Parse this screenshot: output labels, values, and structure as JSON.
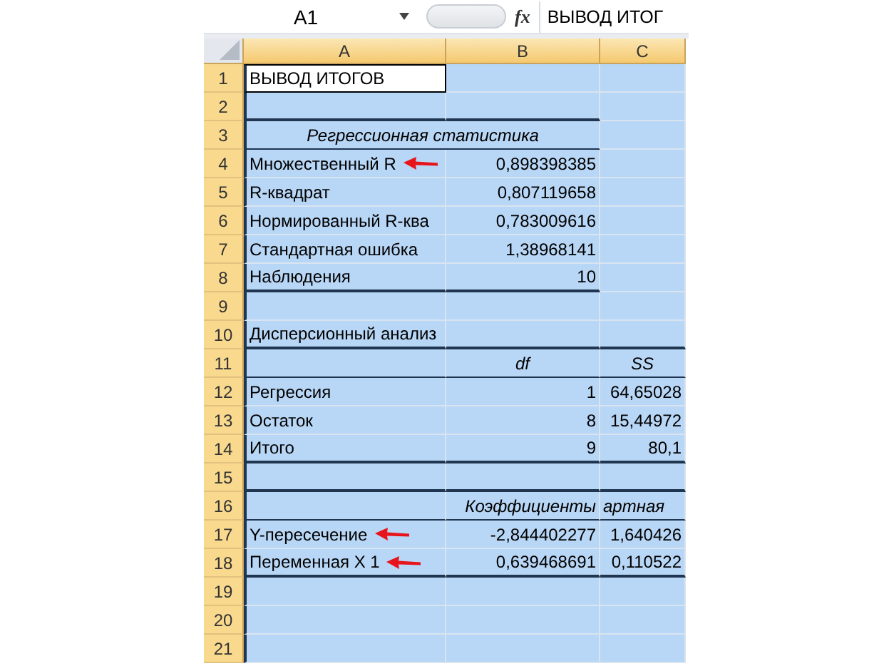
{
  "formula_bar": {
    "name_box": "A1",
    "function_button": "fx",
    "formula": "ВЫВОД ИТОГ"
  },
  "columns": [
    {
      "label": "A",
      "selected": true
    },
    {
      "label": "B",
      "selected": true
    },
    {
      "label": "C",
      "selected": true
    }
  ],
  "rows": [
    {
      "number": "1",
      "selected": true,
      "arrow": false,
      "cells": [
        {
          "text": "ВЫВОД ИТОГОВ",
          "kind": "label",
          "active": true,
          "border_below": false
        },
        {
          "kind": "empty",
          "active": false,
          "border_below": false
        },
        {
          "kind": "empty",
          "active": false,
          "border_below": false
        }
      ]
    },
    {
      "number": "2",
      "selected": true,
      "arrow": false,
      "cells": [
        {
          "kind": "empty",
          "active": false,
          "border_below": true,
          "thick_border": true
        },
        {
          "kind": "empty",
          "active": false,
          "border_below": true,
          "thick_border": true
        },
        {
          "kind": "empty",
          "active": false,
          "border_below": false
        }
      ]
    },
    {
      "number": "3",
      "selected": true,
      "arrow": false,
      "cells": [
        {
          "text": "Регрессионная статистика",
          "kind": "heading_span",
          "active": false,
          "border_below": true,
          "thick_border": false
        },
        {
          "kind": "empty",
          "active": false,
          "border_below": false
        }
      ]
    },
    {
      "number": "4",
      "selected": true,
      "arrow": true,
      "cells": [
        {
          "text": "Множественный R",
          "kind": "label",
          "active": false,
          "border_below": false
        },
        {
          "text": "0,898398385",
          "kind": "number",
          "active": false,
          "border_below": false
        },
        {
          "kind": "empty",
          "active": false,
          "border_below": false
        }
      ]
    },
    {
      "number": "5",
      "selected": true,
      "arrow": false,
      "cells": [
        {
          "text": "R-квадрат",
          "kind": "label",
          "active": false,
          "border_below": false
        },
        {
          "text": "0,807119658",
          "kind": "number",
          "active": false,
          "border_below": false
        },
        {
          "kind": "empty",
          "active": false,
          "border_below": false
        }
      ]
    },
    {
      "number": "6",
      "selected": true,
      "arrow": false,
      "cells": [
        {
          "text": "Нормированный R-ква",
          "kind": "label",
          "active": false,
          "border_below": false
        },
        {
          "text": "0,783009616",
          "kind": "number",
          "active": false,
          "border_below": false
        },
        {
          "kind": "empty",
          "active": false,
          "border_below": false
        }
      ]
    },
    {
      "number": "7",
      "selected": true,
      "arrow": false,
      "cells": [
        {
          "text": "Стандартная ошибка",
          "kind": "label",
          "active": false,
          "border_below": false
        },
        {
          "text": "1,38968141",
          "kind": "number",
          "active": false,
          "border_below": false
        },
        {
          "kind": "empty",
          "active": false,
          "border_below": false
        }
      ]
    },
    {
      "number": "8",
      "selected": true,
      "arrow": false,
      "cells": [
        {
          "text": "Наблюдения",
          "kind": "label",
          "active": false,
          "border_below": true,
          "thick_border": true
        },
        {
          "text": "10",
          "kind": "number",
          "active": false,
          "border_below": true,
          "thick_border": true
        },
        {
          "kind": "empty",
          "active": false,
          "border_below": false
        }
      ]
    },
    {
      "number": "9",
      "selected": true,
      "arrow": false,
      "cells": [
        {
          "kind": "empty",
          "active": false,
          "border_below": false
        },
        {
          "kind": "empty",
          "active": false,
          "border_below": false
        },
        {
          "kind": "empty",
          "active": false,
          "border_below": false
        }
      ]
    },
    {
      "number": "10",
      "selected": true,
      "arrow": false,
      "cells": [
        {
          "text": "Дисперсионный анализ",
          "kind": "label",
          "active": false,
          "border_below": true,
          "thick_border": true
        },
        {
          "kind": "empty",
          "active": false,
          "border_below": true,
          "thick_border": true
        },
        {
          "kind": "empty",
          "active": false,
          "border_below": true,
          "thick_border": true
        }
      ]
    },
    {
      "number": "11",
      "selected": true,
      "arrow": false,
      "cells": [
        {
          "kind": "empty",
          "active": false,
          "border_below": true,
          "thick_border": false
        },
        {
          "text": "df",
          "kind": "heading_center",
          "active": false,
          "border_below": true,
          "thick_border": false
        },
        {
          "text": "SS",
          "kind": "heading_center",
          "active": false,
          "border_below": true,
          "thick_border": false
        }
      ]
    },
    {
      "number": "12",
      "selected": true,
      "arrow": false,
      "cells": [
        {
          "text": "Регрессия",
          "kind": "label",
          "active": false,
          "border_below": false
        },
        {
          "text": "1",
          "kind": "number",
          "active": false,
          "border_below": false
        },
        {
          "text": "64,65028",
          "kind": "number",
          "active": false,
          "border_below": false
        }
      ]
    },
    {
      "number": "13",
      "selected": true,
      "arrow": false,
      "cells": [
        {
          "text": "Остаток",
          "kind": "label",
          "active": false,
          "border_below": false
        },
        {
          "text": "8",
          "kind": "number",
          "active": false,
          "border_below": false
        },
        {
          "text": "15,44972",
          "kind": "number",
          "active": false,
          "border_below": false
        }
      ]
    },
    {
      "number": "14",
      "selected": true,
      "arrow": false,
      "cells": [
        {
          "text": "Итого",
          "kind": "label",
          "active": false,
          "border_below": true,
          "thick_border": true
        },
        {
          "text": "9",
          "kind": "number",
          "active": false,
          "border_below": true,
          "thick_border": true
        },
        {
          "text": "80,1",
          "kind": "number",
          "active": false,
          "border_below": true,
          "thick_border": true
        }
      ]
    },
    {
      "number": "15",
      "selected": true,
      "arrow": false,
      "cells": [
        {
          "kind": "empty",
          "active": false,
          "border_below": true,
          "thick_border": true
        },
        {
          "kind": "empty",
          "active": false,
          "border_below": true,
          "thick_border": true
        },
        {
          "kind": "empty",
          "active": false,
          "border_below": true,
          "thick_border": true
        }
      ]
    },
    {
      "number": "16",
      "selected": true,
      "arrow": false,
      "cells": [
        {
          "kind": "empty",
          "active": false,
          "border_below": true,
          "thick_border": false
        },
        {
          "text": "Коэффициенты",
          "kind": "heading_right",
          "active": false,
          "border_below": true,
          "thick_border": false
        },
        {
          "text": "артная",
          "kind": "heading_left",
          "active": false,
          "border_below": true,
          "thick_border": false
        }
      ]
    },
    {
      "number": "17",
      "selected": true,
      "arrow": true,
      "cells": [
        {
          "text": "Y-пересечение",
          "kind": "label",
          "active": false,
          "border_below": false
        },
        {
          "text": "-2,844402277",
          "kind": "number",
          "active": false,
          "border_below": false
        },
        {
          "text": "1,640426",
          "kind": "number",
          "active": false,
          "border_below": false
        }
      ]
    },
    {
      "number": "18",
      "selected": true,
      "arrow": true,
      "cells": [
        {
          "text": "Переменная X 1",
          "kind": "label",
          "active": false,
          "border_below": true,
          "thick_border": true
        },
        {
          "text": "0,639468691",
          "kind": "number",
          "active": false,
          "border_below": true,
          "thick_border": true
        },
        {
          "text": "0,110522",
          "kind": "number",
          "active": false,
          "border_below": true,
          "thick_border": true
        }
      ]
    },
    {
      "number": "19",
      "selected": true,
      "arrow": false,
      "cells": [
        {
          "kind": "empty",
          "active": false,
          "border_below": false
        },
        {
          "kind": "empty",
          "active": false,
          "border_below": false
        },
        {
          "kind": "empty",
          "active": false,
          "border_below": false
        }
      ]
    },
    {
      "number": "20",
      "selected": true,
      "arrow": false,
      "cells": [
        {
          "kind": "empty",
          "active": false,
          "border_below": false
        },
        {
          "kind": "empty",
          "active": false,
          "border_below": false
        },
        {
          "kind": "empty",
          "active": false,
          "border_below": false
        }
      ]
    },
    {
      "number": "21",
      "selected": true,
      "arrow": false,
      "cells": [
        {
          "kind": "empty",
          "active": false,
          "border_below": false
        },
        {
          "kind": "empty",
          "active": false,
          "border_below": false
        },
        {
          "kind": "empty",
          "active": false,
          "border_below": false
        }
      ]
    }
  ]
}
